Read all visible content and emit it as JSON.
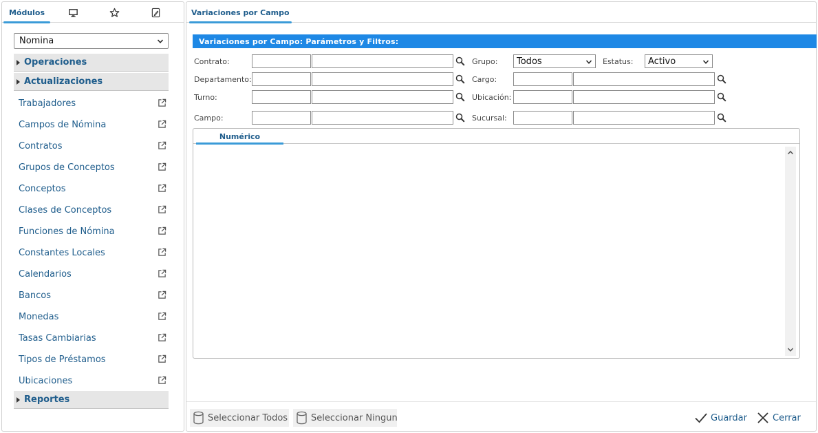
{
  "left_tabs": {
    "modules_label": "Módulos",
    "monitor_icon": "monitor-icon",
    "star_icon": "star-icon",
    "edit_icon": "edit-document-icon"
  },
  "module_select": {
    "value": "Nomina"
  },
  "groups": {
    "operaciones": "Operaciones",
    "actualizaciones": "Actualizaciones",
    "reportes": "Reportes"
  },
  "nav_items": [
    "Trabajadores",
    "Campos de Nómina",
    "Contratos",
    "Grupos de Conceptos",
    "Conceptos",
    "Clases de Conceptos",
    "Funciones de Nómina",
    "Constantes Locales",
    "Calendarios",
    "Bancos",
    "Monedas",
    "Tasas Cambiarias",
    "Tipos de Préstamos",
    "Ubicaciones"
  ],
  "main": {
    "tab_title": "Variaciones por Campo",
    "section_title": "Variaciones por Campo: Parámetros y Filtros:"
  },
  "filters": {
    "contrato": {
      "label": "Contrato:",
      "code": "",
      "description": ""
    },
    "departamento": {
      "label": "Departamento:",
      "code": "",
      "description": ""
    },
    "turno": {
      "label": "Turno:",
      "code": "",
      "description": ""
    },
    "campo": {
      "label": "Campo:",
      "code": "",
      "description": ""
    },
    "grupo": {
      "label": "Grupo:",
      "value": "Todos"
    },
    "estatus": {
      "label": "Estatus:",
      "value": "Activo"
    },
    "cargo": {
      "label": "Cargo:",
      "code": "",
      "description": ""
    },
    "ubicacion": {
      "label": "Ubicación:",
      "code": "",
      "description": ""
    },
    "sucursal": {
      "label": "Sucursal:",
      "code": "",
      "description": ""
    }
  },
  "grid": {
    "tab_label": "Numérico"
  },
  "footer": {
    "select_all": "Seleccionar Todos",
    "select_none": "Seleccionar Ninguno",
    "save": "Guardar",
    "close": "Cerrar"
  }
}
